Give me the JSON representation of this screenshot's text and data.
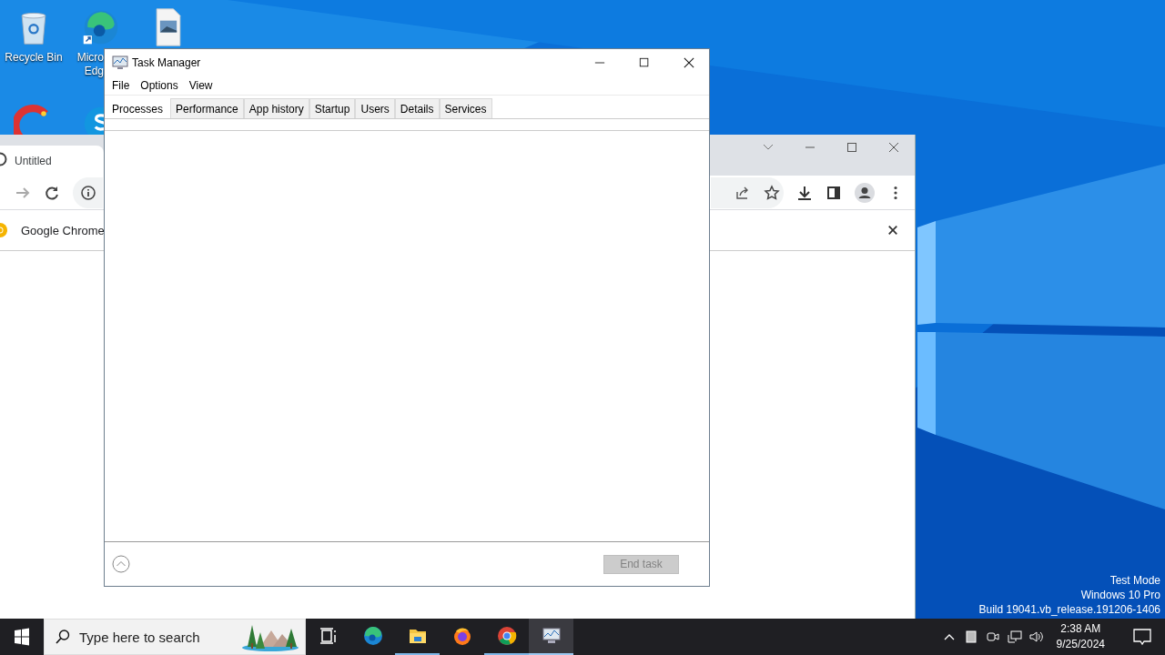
{
  "desktop": {
    "icons": [
      {
        "kind": "recycle",
        "label": [
          "Recycle Bin"
        ]
      },
      {
        "kind": "edge",
        "label": [
          "Micro",
          "Edg"
        ]
      },
      {
        "kind": "file"
      },
      {
        "kind": "ccleaner"
      },
      {
        "kind": "skype"
      }
    ],
    "os_watermark": [
      "Test Mode",
      "Windows 10 Pro",
      "Build 19041.vb_release.191206-1406"
    ]
  },
  "chrome": {
    "tab_title": "Untitled",
    "infobar_text": "Google Chrome"
  },
  "task_manager": {
    "title": "Task Manager",
    "menu": [
      "File",
      "Options",
      "View"
    ],
    "tabs": [
      {
        "label": "Processes",
        "selected": true
      },
      {
        "label": "Performance",
        "selected": false
      },
      {
        "label": "App history",
        "selected": false
      },
      {
        "label": "Startup",
        "selected": false
      },
      {
        "label": "Users",
        "selected": false
      },
      {
        "label": "Details",
        "selected": false
      },
      {
        "label": "Services",
        "selected": false
      }
    ],
    "end_task": {
      "label": "End task",
      "disabled": true
    }
  },
  "taskbar": {
    "search_placeholder": "Type here to search",
    "apps": [
      {
        "kind": "taskview",
        "running": false,
        "active": false
      },
      {
        "kind": "edge",
        "running": false,
        "active": false
      },
      {
        "kind": "explorer",
        "running": true,
        "active": false
      },
      {
        "kind": "firefox",
        "running": false,
        "active": false
      },
      {
        "kind": "chrome",
        "running": true,
        "active": false
      },
      {
        "kind": "taskmgr",
        "running": true,
        "active": true
      }
    ],
    "clock": {
      "time": "2:38 AM",
      "date": "9/25/2024"
    }
  }
}
